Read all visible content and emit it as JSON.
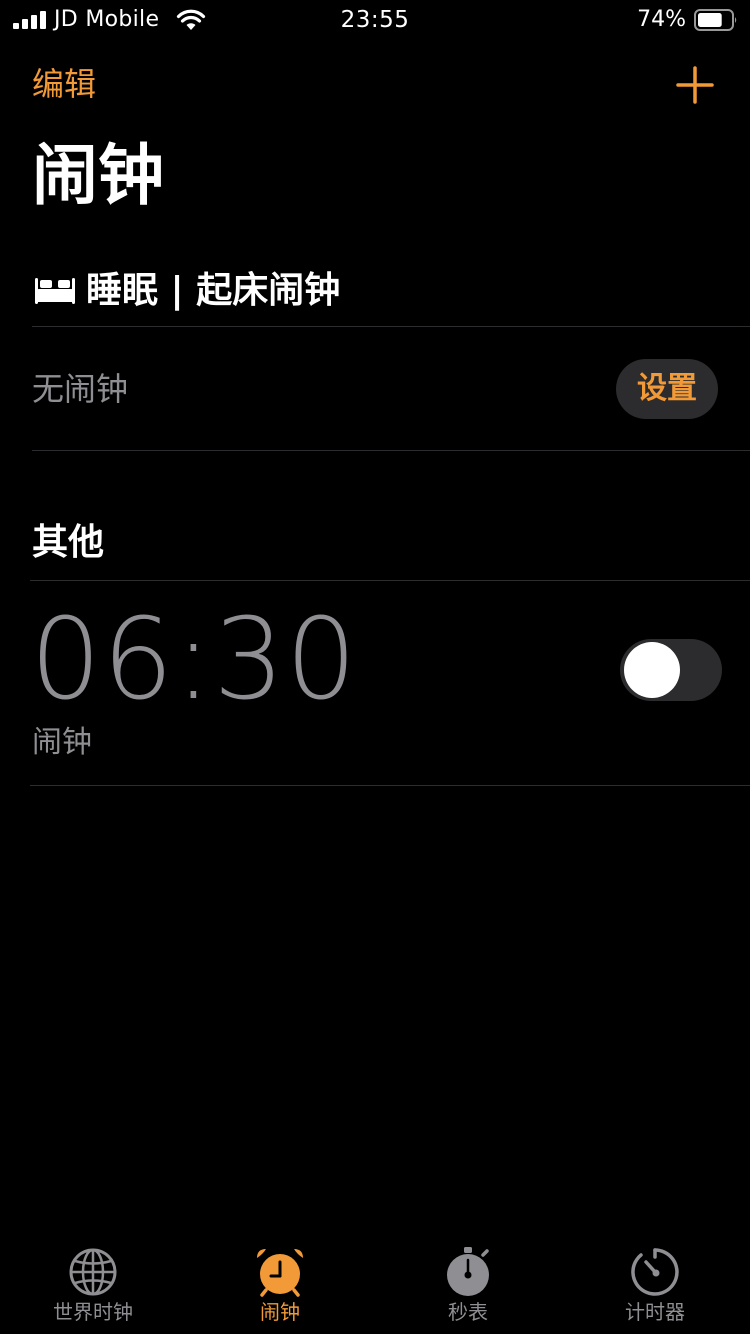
{
  "status_bar": {
    "carrier": "JD Mobile",
    "time": "23:55",
    "battery_percent": "74%",
    "battery_level": 0.74,
    "icons": [
      "signal-icon",
      "wifi-icon",
      "battery-icon"
    ]
  },
  "nav": {
    "edit_label": "编辑",
    "add_icon": "plus-icon"
  },
  "page_title": "闹钟",
  "sleep_section": {
    "icon": "bed-icon",
    "title": "睡眠 | 起床闹钟",
    "empty_text": "无闹钟",
    "set_button": "设置"
  },
  "other_section": {
    "title": "其他",
    "alarms": [
      {
        "time": "06:30",
        "label": "闹钟",
        "enabled": false
      }
    ]
  },
  "tab_bar": {
    "tabs": [
      {
        "label": "世界时钟",
        "icon": "globe-icon",
        "active": false
      },
      {
        "label": "闹钟",
        "icon": "alarm-clock-icon",
        "active": true
      },
      {
        "label": "秒表",
        "icon": "stopwatch-icon",
        "active": false
      },
      {
        "label": "计时器",
        "icon": "timer-icon",
        "active": false
      }
    ]
  },
  "colors": {
    "accent": "#f19a37",
    "background": "#000000",
    "secondary_text": "#8e8e93",
    "fill": "#2c2c2e"
  }
}
